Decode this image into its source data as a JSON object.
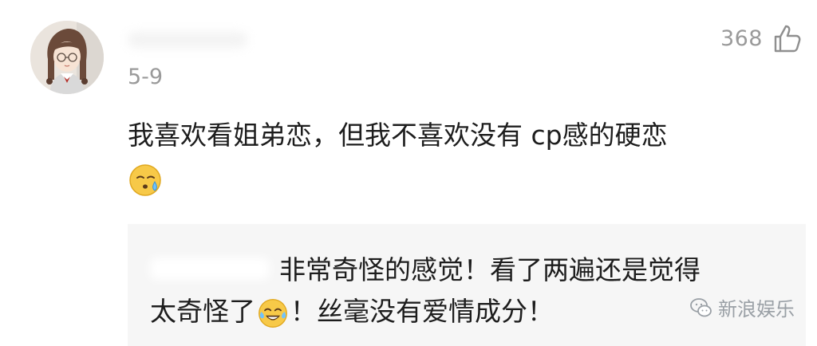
{
  "comment": {
    "likes": "368",
    "date": "5-9",
    "text": "我喜欢看姐弟恋，但我不喜欢没有 cp感的硬恋",
    "emoji": "sleepy-sweat-face"
  },
  "reply": {
    "line1": "非常奇怪的感觉！看了两遍还是觉得",
    "line2_before_emoji": "太奇怪了",
    "line2_after_emoji": "！丝毫没有爱情成分！",
    "emoji": "crying-laughing-face"
  },
  "watermark": {
    "text": "新浪娱乐",
    "icon": "wechat-icon"
  },
  "colors": {
    "text": "#1d1d1d",
    "muted": "#9a9a9a",
    "reply_bg": "#f6f6f6"
  }
}
